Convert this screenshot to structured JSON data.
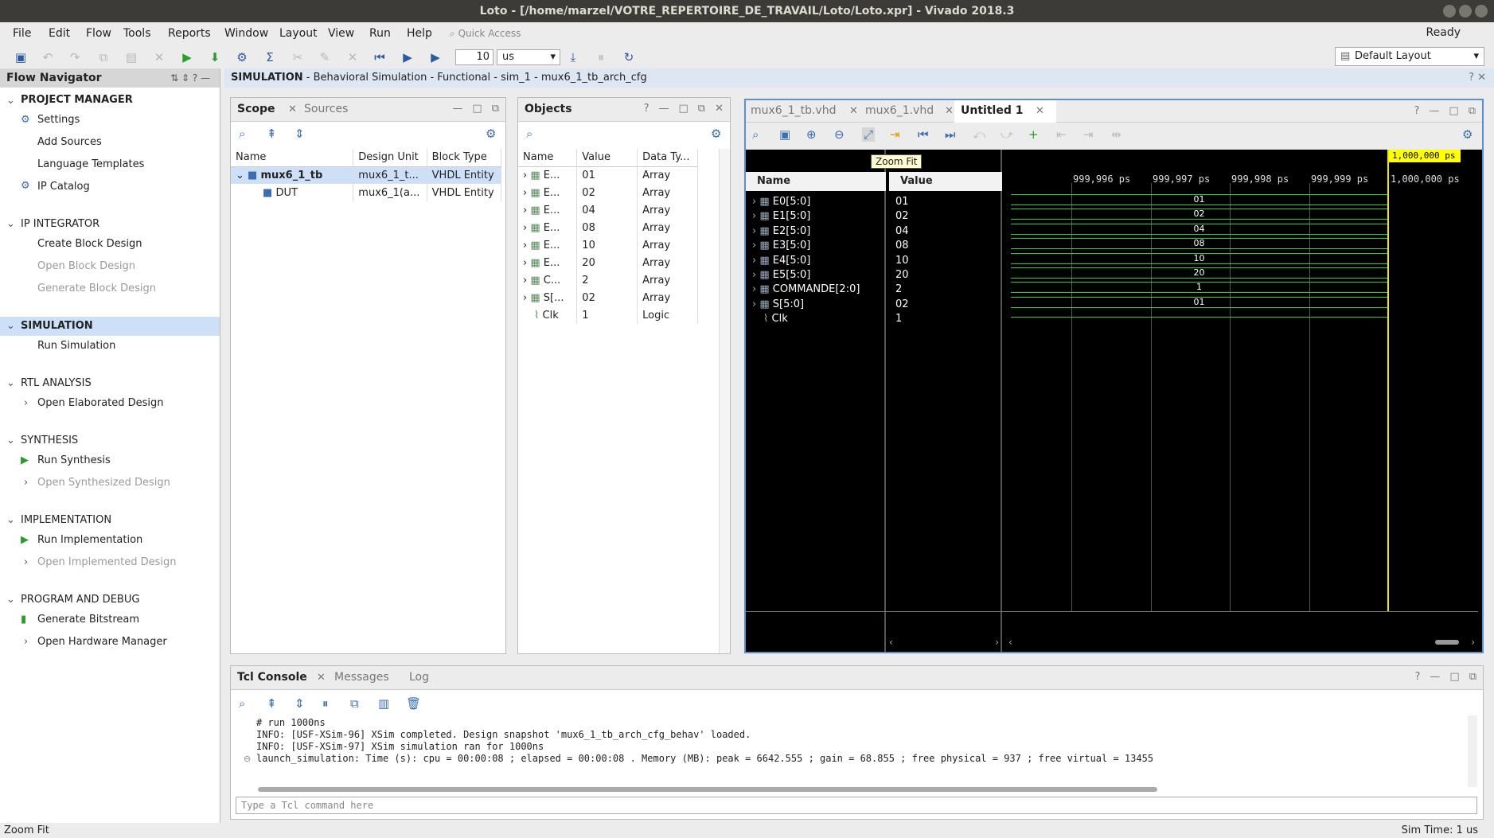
{
  "window": {
    "title": "Loto - [/home/marzel/VOTRE_REPERTOIRE_DE_TRAVAIL/Loto/Loto.xpr] - Vivado 2018.3"
  },
  "menu": [
    "File",
    "Edit",
    "Flow",
    "Tools",
    "Reports",
    "Window",
    "Layout",
    "View",
    "Run",
    "Help"
  ],
  "quick_access": "Quick Access",
  "status_ready": "Ready",
  "toolbar": {
    "time_value": "10",
    "time_unit": "us",
    "layout": "Default Layout"
  },
  "flow_navigator": {
    "title": "Flow Navigator",
    "sections": [
      {
        "label": "PROJECT MANAGER",
        "items": [
          "Settings",
          "Add Sources",
          "Language Templates",
          "IP Catalog"
        ]
      },
      {
        "label": "IP INTEGRATOR",
        "items": [
          "Create Block Design",
          "Open Block Design",
          "Generate Block Design"
        ]
      },
      {
        "label": "SIMULATION",
        "items": [
          "Run Simulation"
        ]
      },
      {
        "label": "RTL ANALYSIS",
        "items": [
          "Open Elaborated Design"
        ]
      },
      {
        "label": "SYNTHESIS",
        "items": [
          "Run Synthesis",
          "Open Synthesized Design"
        ]
      },
      {
        "label": "IMPLEMENTATION",
        "items": [
          "Run Implementation",
          "Open Implemented Design"
        ]
      },
      {
        "label": "PROGRAM AND DEBUG",
        "items": [
          "Generate Bitstream",
          "Open Hardware Manager"
        ]
      }
    ]
  },
  "sim_header": {
    "bold": "SIMULATION",
    "rest": " - Behavioral Simulation - Functional - sim_1 - mux6_1_tb_arch_cfg"
  },
  "scope_panel": {
    "tabs": [
      "Scope",
      "Sources"
    ],
    "columns": [
      "Name",
      "Design Unit",
      "Block Type"
    ],
    "rows": [
      {
        "name": "mux6_1_tb",
        "unit": "mux6_1_t...",
        "type": "VHDL Entity"
      },
      {
        "name": "DUT",
        "unit": "mux6_1(a...",
        "type": "VHDL Entity"
      }
    ]
  },
  "objects_panel": {
    "title": "Objects",
    "columns": [
      "Name",
      "Value",
      "Data Ty..."
    ],
    "rows": [
      {
        "name": "E...",
        "value": "01",
        "type": "Array"
      },
      {
        "name": "E...",
        "value": "02",
        "type": "Array"
      },
      {
        "name": "E...",
        "value": "04",
        "type": "Array"
      },
      {
        "name": "E...",
        "value": "08",
        "type": "Array"
      },
      {
        "name": "E...",
        "value": "10",
        "type": "Array"
      },
      {
        "name": "E...",
        "value": "20",
        "type": "Array"
      },
      {
        "name": "C...",
        "value": "2",
        "type": "Array"
      },
      {
        "name": "S[...",
        "value": "02",
        "type": "Array"
      },
      {
        "name": "Clk",
        "value": "1",
        "type": "Logic"
      }
    ]
  },
  "wave_window": {
    "tabs": [
      "mux6_1_tb.vhd",
      "mux6_1.vhd",
      "Untitled 1"
    ],
    "tooltip": "Zoom Fit",
    "name_header": "Name",
    "value_header": "Value",
    "cursor_label": "1,000,000 ps",
    "ticks": [
      "999,996 ps",
      "999,997 ps",
      "999,998 ps",
      "999,999 ps",
      "1,000,000 ps"
    ],
    "signals": [
      {
        "name": "E0[5:0]",
        "value": "01",
        "wave": "01"
      },
      {
        "name": "E1[5:0]",
        "value": "02",
        "wave": "02"
      },
      {
        "name": "E2[5:0]",
        "value": "04",
        "wave": "04"
      },
      {
        "name": "E3[5:0]",
        "value": "08",
        "wave": "08"
      },
      {
        "name": "E4[5:0]",
        "value": "10",
        "wave": "10"
      },
      {
        "name": "E5[5:0]",
        "value": "20",
        "wave": "20"
      },
      {
        "name": "COMMANDE[2:0]",
        "value": "2",
        "wave": "1"
      },
      {
        "name": "S[5:0]",
        "value": "02",
        "wave": "01"
      },
      {
        "name": "Clk",
        "value": "1",
        "wave": ""
      }
    ]
  },
  "console": {
    "tabs": [
      "Tcl Console",
      "Messages",
      "Log"
    ],
    "lines": [
      "# run 1000ns",
      "INFO: [USF-XSim-96] XSim completed. Design snapshot 'mux6_1_tb_arch_cfg_behav' loaded.",
      "INFO: [USF-XSim-97] XSim simulation ran for 1000ns",
      "launch_simulation: Time (s): cpu = 00:00:08 ; elapsed = 00:00:08 . Memory (MB): peak = 6642.555 ; gain = 68.855 ; free physical = 937 ; free virtual = 13455"
    ],
    "input_placeholder": "Type a Tcl command here"
  },
  "statusbar": {
    "left": "Zoom Fit",
    "right": "Sim Time: 1 us"
  }
}
